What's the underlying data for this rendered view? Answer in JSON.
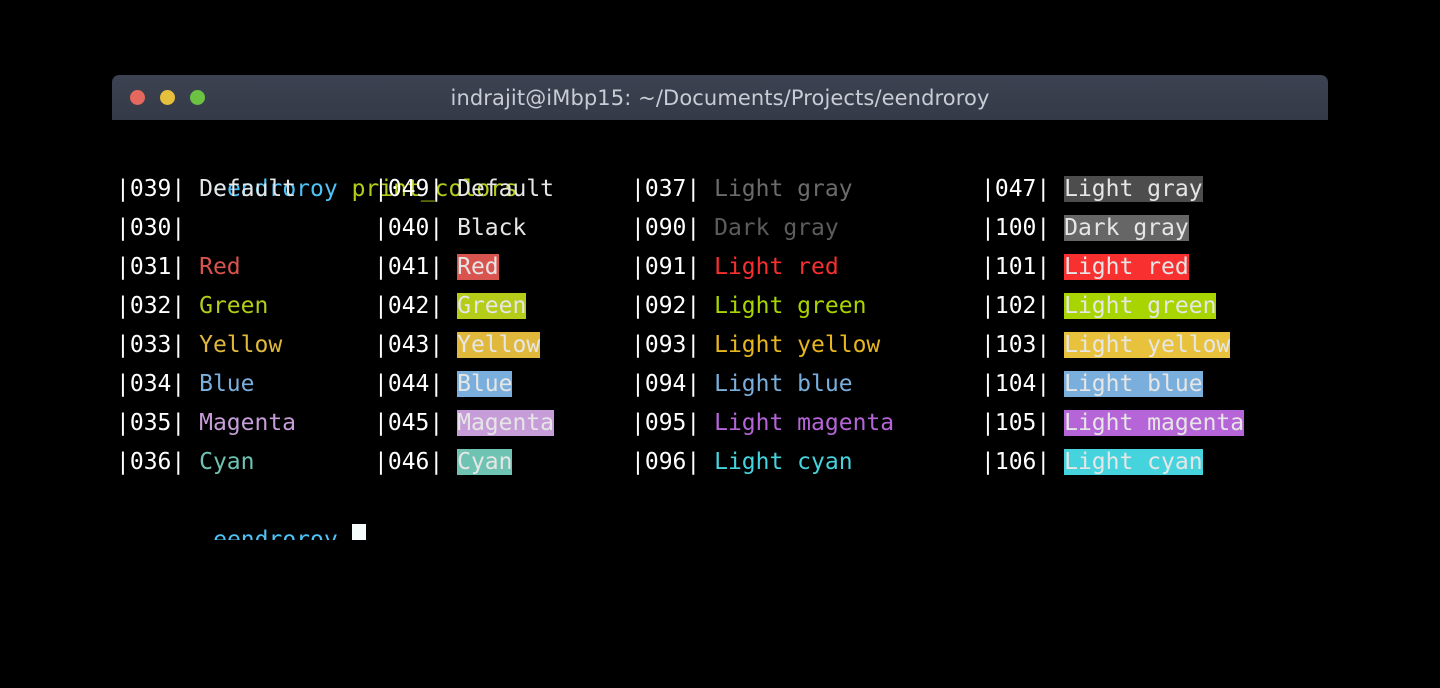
{
  "window": {
    "title": "indrajit@iMbp15: ~/Documents/Projects/eendroroy",
    "buttons": {
      "close": "close-button",
      "minimize": "minimize-button",
      "maximize": "maximize-button"
    },
    "colors": {
      "titlebar_bg": "#3a4050",
      "terminal_bg": "#000000",
      "close": "#e4685d",
      "minimize": "#e5c03c",
      "maximize": "#6bc243"
    }
  },
  "terminal": {
    "prompt_top": {
      "user": "eendroroy",
      "command": "print_colors",
      "user_color": "#4fc3f7",
      "command_color": "#b5cc18"
    },
    "prompt_bottom": {
      "user": "eendroroy",
      "command": "",
      "user_color": "#4fc3f7",
      "cursor": "block"
    },
    "columns": [
      {
        "name": "foreground-normal",
        "rows": [
          {
            "code": "|039|",
            "label": "Default",
            "fg": "#e6e6e6",
            "bg": "transparent"
          },
          {
            "code": "|030|",
            "label": "",
            "fg": "#1a1a1a",
            "bg": "transparent"
          },
          {
            "code": "|031|",
            "label": "Red",
            "fg": "#d9534f",
            "bg": "transparent"
          },
          {
            "code": "|032|",
            "label": "Green",
            "fg": "#b5cc18",
            "bg": "transparent"
          },
          {
            "code": "|033|",
            "label": "Yellow",
            "fg": "#e0b93c",
            "bg": "transparent"
          },
          {
            "code": "|034|",
            "label": "Blue",
            "fg": "#7aafdd",
            "bg": "transparent"
          },
          {
            "code": "|035|",
            "label": "Magenta",
            "fg": "#c69dd8",
            "bg": "transparent"
          },
          {
            "code": "|036|",
            "label": "Cyan",
            "fg": "#6ec3b2",
            "bg": "transparent"
          }
        ]
      },
      {
        "name": "background-normal",
        "rows": [
          {
            "code": "|049|",
            "label": "Default",
            "fg": "#e6e6e6",
            "bg": "transparent"
          },
          {
            "code": "|040|",
            "label": "Black",
            "fg": "#e6e6e6",
            "bg": "#000000"
          },
          {
            "code": "|041|",
            "label": "Red",
            "fg": "#e6e6e6",
            "bg": "#d9534f"
          },
          {
            "code": "|042|",
            "label": "Green",
            "fg": "#e6e6e6",
            "bg": "#b5cc18"
          },
          {
            "code": "|043|",
            "label": "Yellow",
            "fg": "#e6e6e6",
            "bg": "#e0b93c"
          },
          {
            "code": "|044|",
            "label": "Blue",
            "fg": "#e6e6e6",
            "bg": "#7aafdd"
          },
          {
            "code": "|045|",
            "label": "Magenta",
            "fg": "#e6e6e6",
            "bg": "#c69dd8"
          },
          {
            "code": "|046|",
            "label": "Cyan",
            "fg": "#e6e6e6",
            "bg": "#6ec3b2"
          }
        ]
      },
      {
        "name": "foreground-bright",
        "rows": [
          {
            "code": "|037|",
            "label": "Light gray",
            "fg": "#6b6b6b",
            "bg": "transparent"
          },
          {
            "code": "|090|",
            "label": "Dark gray",
            "fg": "#5c5c5c",
            "bg": "transparent"
          },
          {
            "code": "|091|",
            "label": "Light red",
            "fg": "#f82f2f",
            "bg": "transparent"
          },
          {
            "code": "|092|",
            "label": "Light green",
            "fg": "#a8d500",
            "bg": "transparent"
          },
          {
            "code": "|093|",
            "label": "Light yellow",
            "fg": "#e8b71e",
            "bg": "transparent"
          },
          {
            "code": "|094|",
            "label": "Light blue",
            "fg": "#7aafdd",
            "bg": "transparent"
          },
          {
            "code": "|095|",
            "label": "Light magenta",
            "fg": "#b565d8",
            "bg": "transparent"
          },
          {
            "code": "|096|",
            "label": "Light cyan",
            "fg": "#45d4de",
            "bg": "transparent"
          }
        ]
      },
      {
        "name": "background-bright",
        "rows": [
          {
            "code": "|047|",
            "label": "Light gray",
            "fg": "#e6e6e6",
            "bg": "#4d4d4d"
          },
          {
            "code": "|100|",
            "label": "Dark gray",
            "fg": "#e6e6e6",
            "bg": "#666666"
          },
          {
            "code": "|101|",
            "label": "Light red",
            "fg": "#e6e6e6",
            "bg": "#f83030"
          },
          {
            "code": "|102|",
            "label": "Light green",
            "fg": "#e6e6e6",
            "bg": "#a8d500"
          },
          {
            "code": "|103|",
            "label": "Light yellow",
            "fg": "#e6e6e6",
            "bg": "#e8c23c"
          },
          {
            "code": "|104|",
            "label": "Light blue",
            "fg": "#e6e6e6",
            "bg": "#7aafdd"
          },
          {
            "code": "|105|",
            "label": "Light magenta",
            "fg": "#e6e6e6",
            "bg": "#b565d8"
          },
          {
            "code": "|106|",
            "label": "Light cyan",
            "fg": "#e6e6e6",
            "bg": "#45d4de"
          }
        ]
      }
    ]
  }
}
